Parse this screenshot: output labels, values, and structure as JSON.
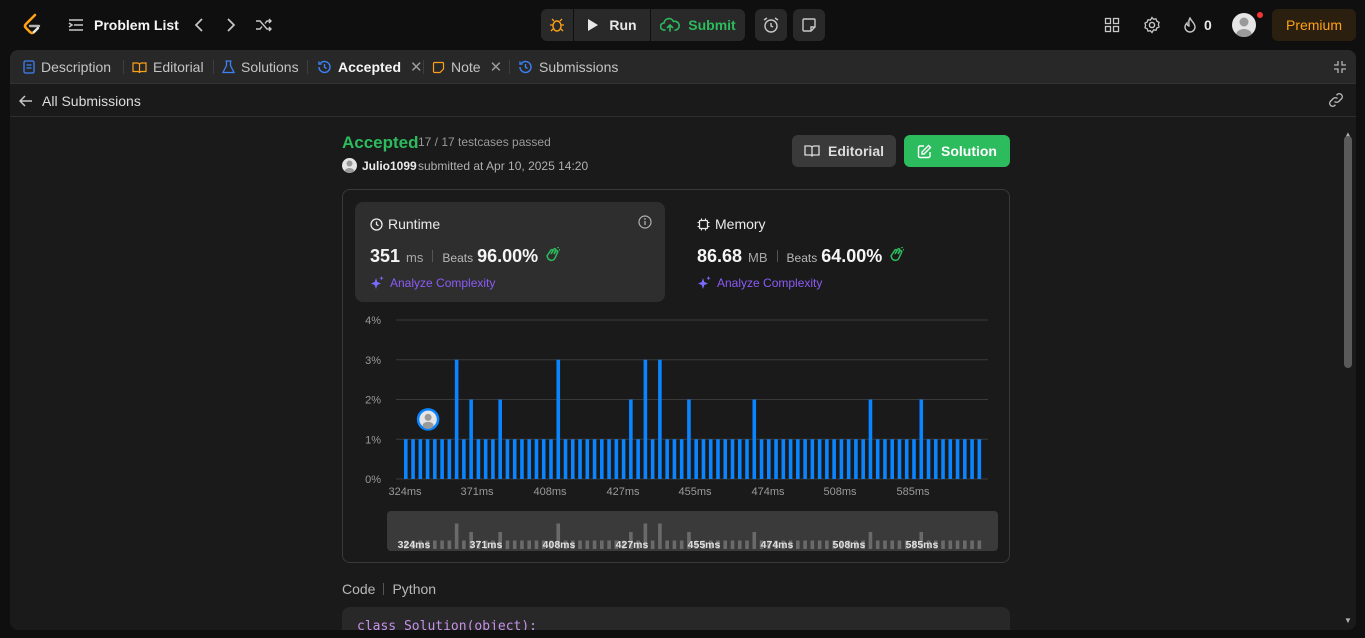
{
  "header": {
    "problem_list": "Problem List",
    "run": "Run",
    "submit": "Submit",
    "streak": "0",
    "premium": "Premium"
  },
  "tabs": [
    {
      "label": "Description"
    },
    {
      "label": "Editorial"
    },
    {
      "label": "Solutions"
    },
    {
      "label": "Accepted"
    },
    {
      "label": "Note"
    },
    {
      "label": "Submissions"
    }
  ],
  "subheader": {
    "back": "All Submissions"
  },
  "result": {
    "status": "Accepted",
    "testcases": "17 / 17 testcases passed",
    "user": "Julio1099",
    "submitted_at": "submitted at Apr 10, 2025 14:20",
    "editorial_btn": "Editorial",
    "solution_btn": "Solution"
  },
  "runtime": {
    "title": "Runtime",
    "value": "351",
    "unit": "ms",
    "beats_label": "Beats",
    "beats": "96.00%",
    "analyze": "Analyze Complexity"
  },
  "memory": {
    "title": "Memory",
    "value": "86.68",
    "unit": "MB",
    "beats_label": "Beats",
    "beats": "64.00%",
    "analyze": "Analyze Complexity"
  },
  "code": {
    "label": "Code",
    "lang": "Python",
    "first_line": "class Solution(object):"
  },
  "colors": {
    "accent_green": "#2cbb5d",
    "bar_blue": "#0a84ff",
    "premium_orange": "#ffa116",
    "ai_purple": "#8c5bf7"
  },
  "chart_data": {
    "type": "bar",
    "ylabel_ticks": [
      "4%",
      "3%",
      "2%",
      "1%",
      "0%"
    ],
    "ylim": [
      0,
      4
    ],
    "x_ticks": [
      "324ms",
      "371ms",
      "408ms",
      "427ms",
      "455ms",
      "474ms",
      "508ms",
      "585ms"
    ],
    "values": [
      1,
      1,
      1,
      1,
      1,
      1,
      1,
      3,
      1,
      2,
      1,
      1,
      1,
      2,
      1,
      1,
      1,
      1,
      1,
      1,
      1,
      3,
      1,
      1,
      1,
      1,
      1,
      1,
      1,
      1,
      1,
      2,
      1,
      3,
      1,
      3,
      1,
      1,
      1,
      2,
      1,
      1,
      1,
      1,
      1,
      1,
      1,
      1,
      2,
      1,
      1,
      1,
      1,
      1,
      1,
      1,
      1,
      1,
      1,
      1,
      1,
      1,
      1,
      1,
      2,
      1,
      1,
      1,
      1,
      1,
      1,
      2,
      1,
      1,
      1,
      1,
      1,
      1,
      1,
      1
    ],
    "marker_index": 3,
    "grid": true
  }
}
